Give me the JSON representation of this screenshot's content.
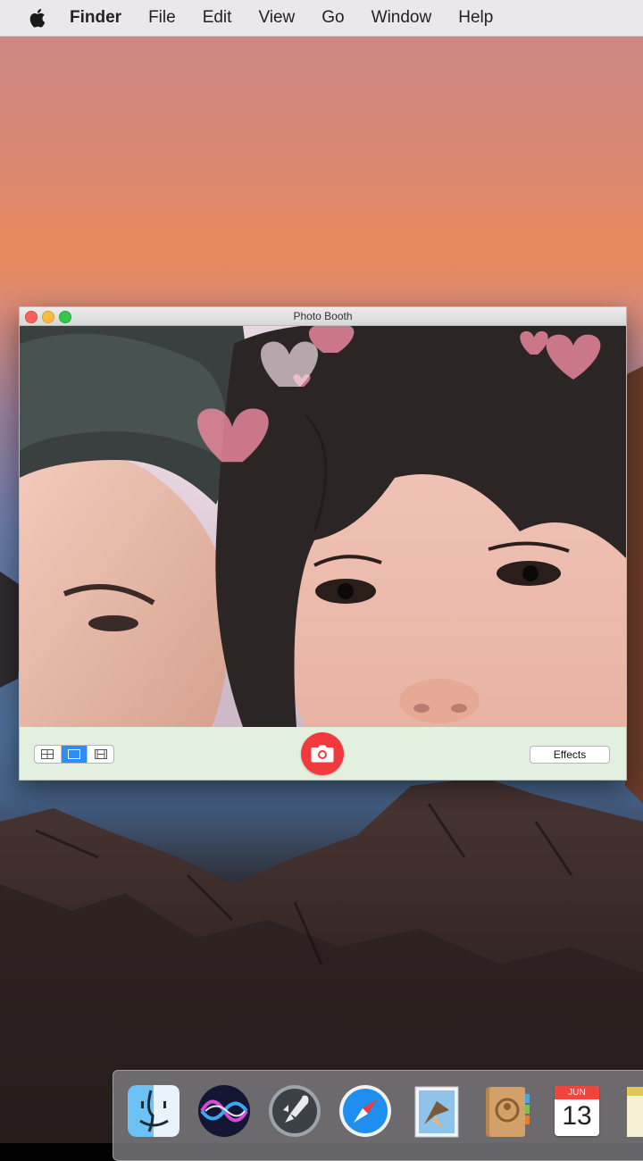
{
  "menubar": {
    "apple_icon": "apple-logo-icon",
    "items": [
      "Finder",
      "File",
      "Edit",
      "View",
      "Go",
      "Window",
      "Help"
    ]
  },
  "window": {
    "title": "Photo Booth",
    "effects_label": "Effects",
    "layout_buttons": [
      "four-up-grid-icon",
      "single-photo-icon",
      "video-clip-icon"
    ],
    "active_layout_index": 1,
    "shutter_icon": "camera-icon"
  },
  "dock": {
    "apps": [
      "finder-icon",
      "siri-icon",
      "launchpad-icon",
      "safari-icon",
      "mail-icon",
      "contacts-icon",
      "calendar-icon"
    ],
    "calendar_month": "JUN",
    "calendar_day": "13"
  },
  "colors": {
    "shutter": "#f03a3e",
    "active_segment": "#2f8cf2",
    "toolbar": "#e3f0e0",
    "hearts": "#e8889c"
  }
}
